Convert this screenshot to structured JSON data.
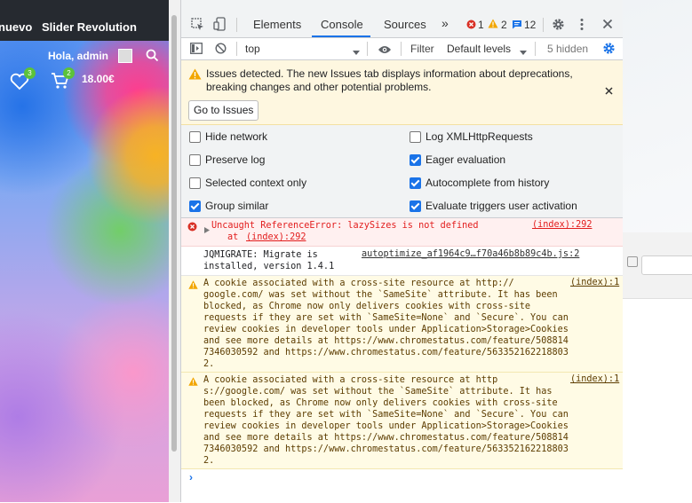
{
  "website": {
    "nav_items": [
      "nuevo",
      "Slider Revolution"
    ],
    "greeting": "Hola, admin",
    "wishlist_count": "3",
    "cart_count": "2",
    "cart_total": "18.00€"
  },
  "devtools": {
    "tabs": [
      {
        "label": "Elements",
        "active": false
      },
      {
        "label": "Console",
        "active": true
      },
      {
        "label": "Sources",
        "active": false
      }
    ],
    "more_tabs": "»",
    "error_count": "1",
    "warning_count": "2",
    "info_count": "12",
    "context": "top",
    "filter_placeholder": "Filter",
    "levels": "Default levels",
    "hidden_count": "5 hidden",
    "issues_banner": {
      "text": "Issues detected. The new Issues tab displays information about deprecations, breaking changes and other potential problems.",
      "button": "Go to Issues"
    },
    "settings": [
      {
        "label": "Hide network",
        "checked": false
      },
      {
        "label": "Log XMLHttpRequests",
        "checked": false
      },
      {
        "label": "Preserve log",
        "checked": false
      },
      {
        "label": "Eager evaluation",
        "checked": true
      },
      {
        "label": "Selected context only",
        "checked": false
      },
      {
        "label": "Autocomplete from history",
        "checked": true
      },
      {
        "label": "Group similar",
        "checked": true
      },
      {
        "label": "Evaluate triggers user activation",
        "checked": true
      }
    ],
    "messages": {
      "error": {
        "text": "Uncaught ReferenceError: lazySizes is not defined",
        "at_prefix": "at ",
        "at_link": "(index):292",
        "source": "(index):292"
      },
      "info": {
        "line1": "JQMIGRATE: Migrate is",
        "line2": "installed, version 1.4.1",
        "source": "autoptimize_af1964c9…f70a46b8b89c4b.js:2"
      },
      "warn1": {
        "lines": [
          "A cookie associated with a cross-site resource at http://",
          "google.com/ was set without the `SameSite` attribute. It has been",
          "blocked, as Chrome now only delivers cookies with cross-site",
          "requests if they are set with `SameSite=None` and `Secure`. You can",
          "review cookies in developer tools under Application>Storage>Cookies",
          "and see more details at https://www.chromestatus.com/feature/508814",
          "7346030592 and https://www.chromestatus.com/feature/563352162218803",
          "2."
        ],
        "source": "(index):1"
      },
      "warn2": {
        "lines": [
          "A cookie associated with a cross-site resource at http",
          "s://google.com/ was set without the `SameSite` attribute. It has",
          "been blocked, as Chrome now only delivers cookies with cross-site",
          "requests if they are set with `SameSite=None` and `Secure`. You can",
          "review cookies in developer tools under Application>Storage>Cookies",
          "and see more details at https://www.chromestatus.com/feature/508814",
          "7346030592 and https://www.chromestatus.com/feature/563352162218803",
          "2."
        ],
        "source": "(index):1"
      }
    },
    "prompt": "›"
  }
}
